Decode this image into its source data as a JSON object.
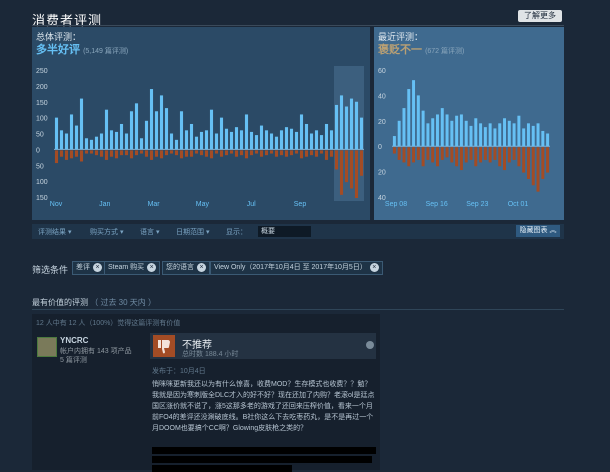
{
  "header": {
    "title": "消费者评测",
    "learn_more": "了解更多"
  },
  "overall": {
    "label": "总体评测：",
    "score": "多半好评",
    "count": "(5,149 篇评测)",
    "score_color": "#66c0f4"
  },
  "recent": {
    "label": "最近评测：",
    "score": "褒贬不一",
    "count": "(672 篇评测)",
    "score_color": "#b9a074"
  },
  "chart_data": [
    {
      "type": "bar",
      "title": "",
      "y_ticks": [
        "250",
        "200",
        "150",
        "100",
        "50",
        "0",
        "50",
        "100",
        "150"
      ],
      "ylim": [
        -150,
        250
      ],
      "x_ticks": [
        "Nov",
        "Jan",
        "Mar",
        "May",
        "Jul",
        "Sep"
      ],
      "series": [
        {
          "name": "",
          "color": "#66c0f4",
          "values": [
            100,
            60,
            50,
            110,
            75,
            160,
            35,
            30,
            40,
            50,
            125,
            60,
            55,
            80,
            50,
            120,
            145,
            35,
            90,
            190,
            120,
            170,
            130,
            50,
            30,
            120,
            60,
            80,
            40,
            55,
            60,
            125,
            50,
            100,
            65,
            55,
            70,
            60,
            110,
            55,
            45,
            75,
            60,
            50,
            40,
            60,
            70,
            65,
            55,
            110,
            80,
            50,
            60,
            45,
            80,
            60,
            140,
            170,
            135,
            160,
            150,
            100
          ]
        },
        {
          "name": "",
          "color": "#a34c25",
          "values": [
            -40,
            -20,
            -30,
            -25,
            -20,
            -35,
            -10,
            -10,
            -15,
            -20,
            -30,
            -20,
            -25,
            -15,
            -15,
            -25,
            -15,
            -10,
            -20,
            -30,
            -20,
            -25,
            -15,
            -10,
            -15,
            -25,
            -20,
            -20,
            -10,
            -15,
            -20,
            -25,
            -10,
            -20,
            -15,
            -10,
            -20,
            -15,
            -25,
            -15,
            -10,
            -20,
            -15,
            -10,
            -20,
            -15,
            -20,
            -15,
            -10,
            -25,
            -20,
            -15,
            -20,
            -10,
            -30,
            -20,
            -60,
            -140,
            -100,
            -120,
            -150,
            -80
          ]
        }
      ]
    },
    {
      "type": "bar",
      "title": "",
      "y_ticks": [
        "60",
        "40",
        "20",
        "0",
        "20",
        "40"
      ],
      "ylim": [
        -40,
        60
      ],
      "x_ticks": [
        "Sep 08",
        "Sep 16",
        "Sep 23",
        "Oct 01"
      ],
      "series": [
        {
          "name": "",
          "color": "#66c0f4",
          "values": [
            8,
            20,
            30,
            45,
            52,
            40,
            28,
            18,
            22,
            25,
            30,
            25,
            20,
            24,
            25,
            20,
            16,
            22,
            18,
            15,
            18,
            14,
            18,
            22,
            20,
            18,
            24,
            14,
            18,
            16,
            18,
            12,
            10
          ]
        },
        {
          "name": "",
          "color": "#a34c25",
          "values": [
            -5,
            -10,
            -12,
            -15,
            -12,
            -10,
            -15,
            -10,
            -12,
            -15,
            -10,
            -8,
            -12,
            -15,
            -18,
            -12,
            -10,
            -15,
            -12,
            -10,
            -12,
            -10,
            -15,
            -18,
            -12,
            -10,
            -15,
            -20,
            -25,
            -30,
            -35,
            -25,
            -20
          ]
        }
      ]
    }
  ],
  "filters": {
    "items": [
      "评测结果",
      "购买方式",
      "语言",
      "日期范围"
    ],
    "show_label": "显示：",
    "show_value": "概要",
    "hide_graph": "隐藏图表"
  },
  "active_filters": {
    "label": "筛选条件",
    "chips": [
      "差评",
      "Steam 购买",
      "您的语言",
      "View Only（2017年10月4日 至 2017年10月5日）"
    ]
  },
  "helpful": {
    "title": "最有价值的评测",
    "range": "（ 过去 30 天内 ）"
  },
  "review": {
    "helpful_line": "12 人中有 12 人（100%）觉得这篇评测有价值",
    "user": "YNCRC",
    "owned": "帐户内拥有 143 项产品",
    "reviews": "5 篇评测",
    "verdict": "不推荐",
    "hours": "总时数 188.4 小时",
    "posted": "发布于：10月4日",
    "body": "悄咪咪更新我还以为有什么惊喜，收费MOD？生存模式也收费？？勉？我就是因为寒刺版全DLC才入的好不好？现在还加了内购？老滚ol是廷点国区涨价就不说了，涨5这那多老的游戏了还回来压榨价值，看来一个月前FO4的差评还没涮破底线。B社你这么下去吃枣药丸，是不是再过一个月DOOM也要搞个CC啊？Glowing皮肤枪之类的？"
  }
}
